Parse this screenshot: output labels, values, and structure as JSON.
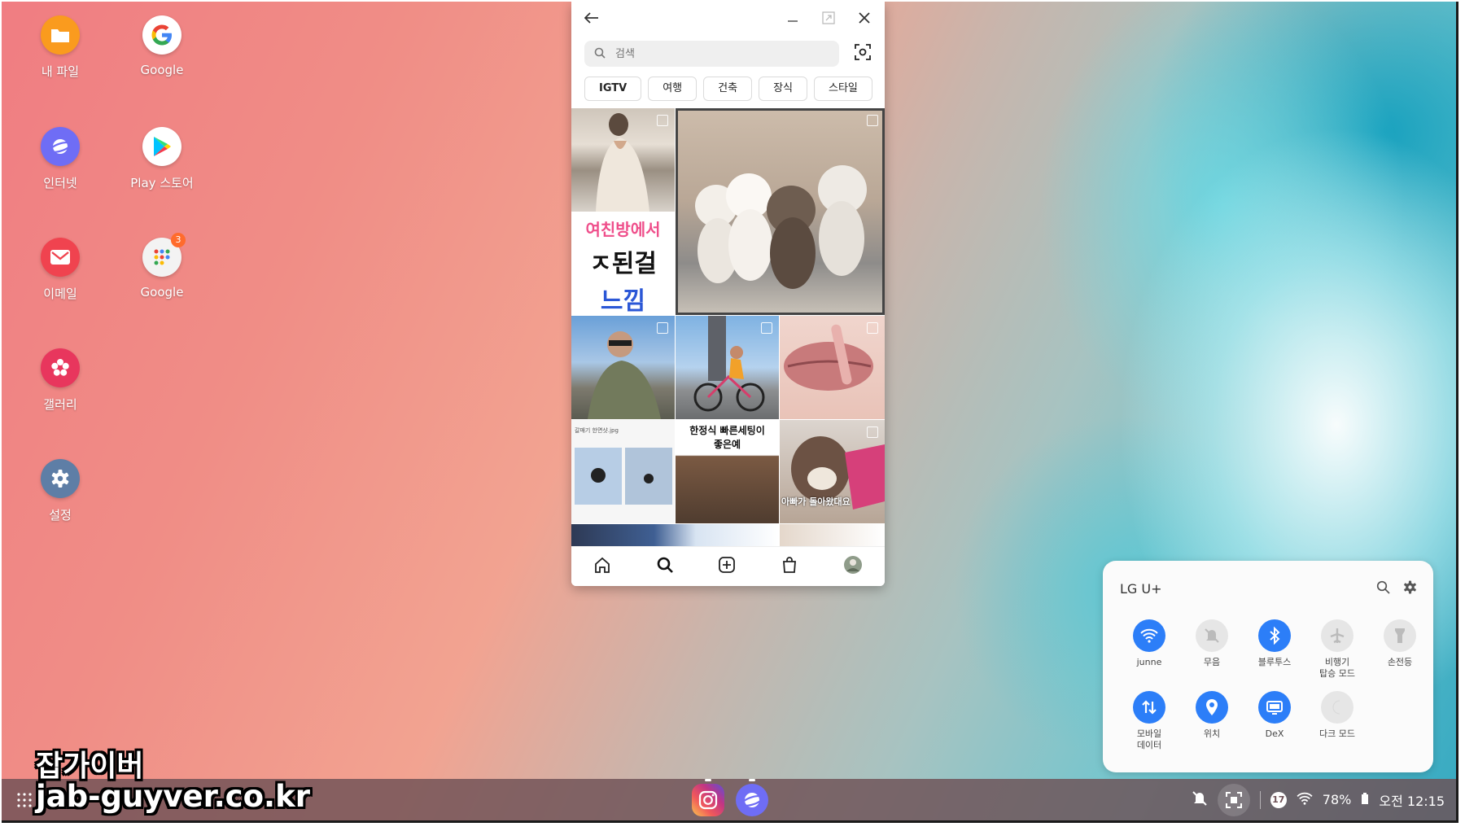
{
  "desktop": {
    "icons": [
      {
        "label": "내 파일",
        "icon": "folder-icon",
        "color": "#fa9b1e"
      },
      {
        "label": "Google",
        "icon": "google-icon",
        "color": "#ffffff"
      },
      {
        "label": "인터넷",
        "icon": "samsung-internet-icon",
        "color": "#6f6df5"
      },
      {
        "label": "Play 스토어",
        "icon": "play-store-icon",
        "color": "#ffffff"
      },
      {
        "label": "이메일",
        "icon": "email-icon",
        "color": "#f0434f"
      },
      {
        "label": "Google",
        "icon": "google-folder-icon",
        "color": "#f3f3f3",
        "badge": "3"
      },
      {
        "label": "갤러리",
        "icon": "gallery-icon",
        "color": "#e8365d"
      },
      {
        "label": "설정",
        "icon": "settings-icon",
        "color": "#5e7ea6"
      }
    ]
  },
  "instagram": {
    "search_placeholder": "검색",
    "chips": [
      "IGTV",
      "여행",
      "건축",
      "장식",
      "스타일"
    ],
    "tile_texts": {
      "pink_line": "여친방에서",
      "black_line": "ㅈ된걸",
      "blue_line": "느낌",
      "caption_file": "갈매기 한면샷.jpg",
      "caption_title_1": "한정식 빠른세팅이",
      "caption_title_2": "좋은예",
      "caption_dog": "아빠가 돌아왔대요"
    }
  },
  "quick_panel": {
    "carrier": "LG U+",
    "tiles": [
      {
        "label": "junne",
        "icon": "wifi-icon",
        "on": true
      },
      {
        "label": "무음",
        "icon": "mute-icon",
        "on": false
      },
      {
        "label": "블루투스",
        "icon": "bluetooth-icon",
        "on": true
      },
      {
        "label": "비행기\n탑승 모드",
        "icon": "airplane-icon",
        "on": false
      },
      {
        "label": "손전등",
        "icon": "flashlight-icon",
        "on": false
      },
      {
        "label": "모바일\n데이터",
        "icon": "mobile-data-icon",
        "on": true
      },
      {
        "label": "위치",
        "icon": "location-icon",
        "on": true
      },
      {
        "label": "DeX",
        "icon": "dex-icon",
        "on": true
      },
      {
        "label": "다크 모드",
        "icon": "dark-mode-icon",
        "on": false
      }
    ],
    "accent": "#2c7ef8"
  },
  "taskbar": {
    "notification_count": "17",
    "battery": "78%",
    "clock": "오전 12:15"
  },
  "watermark": {
    "line1": "잡가이버",
    "line2": "jab-guyver.co.kr"
  }
}
